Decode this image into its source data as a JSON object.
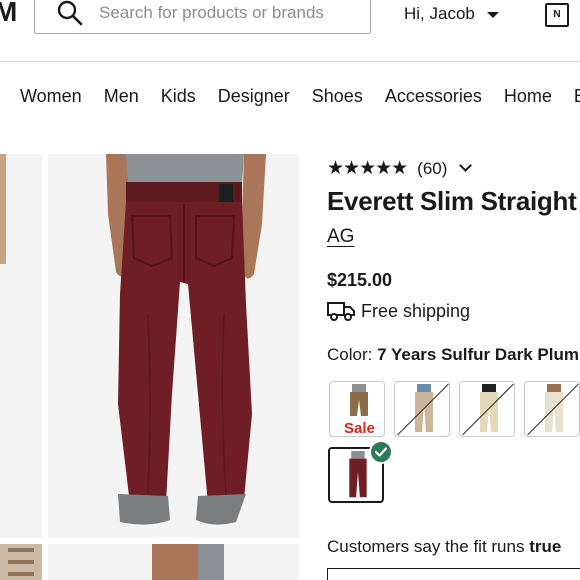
{
  "header": {
    "logo_fragment": "M",
    "search_placeholder": "Search for products or brands",
    "greeting": "Hi, Jacob",
    "brand_mark": "N"
  },
  "nav": {
    "items": [
      "Women",
      "Men",
      "Kids",
      "Designer",
      "Shoes",
      "Accessories",
      "Home",
      "B"
    ]
  },
  "product": {
    "rating_stars": "★★★★★",
    "review_count": "(60)",
    "title": "Everett Slim Straight",
    "brand": "AG",
    "price": "$215.00",
    "shipping": "Free shipping",
    "color_label": "Color:",
    "color_value": "7 Years Sulfur Dark Plum",
    "sale_label": "Sale",
    "fit_text": "Customers say the fit runs",
    "fit_value": "true"
  },
  "colors": {
    "accent_green": "#2c7a57",
    "sale_red": "#d6261d",
    "pants_plum": "#6e1e24"
  }
}
